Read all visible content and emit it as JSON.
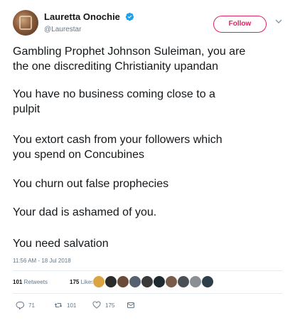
{
  "user": {
    "display_name": "Lauretta Onochie",
    "handle": "@Laurestar",
    "verified": true,
    "follow_label": "Follow"
  },
  "tweet": {
    "paragraphs": [
      [
        "Gambling Prophet Johnson Suleiman, you are",
        "the one discrediting Christianity upandan"
      ],
      [
        "You have no business coming close to a",
        "pulpit"
      ],
      [
        "You extort cash from your followers which",
        "you spend  on Concubines"
      ],
      [
        "You churn out false prophecies"
      ],
      [
        "Your dad is ashamed of you."
      ],
      [
        "You need salvation"
      ]
    ],
    "timestamp": "11:56 AM - 18 Jul 2018"
  },
  "stats": {
    "retweets_count": "101",
    "retweets_label": "Retweets",
    "likes_count": "175",
    "likes_label": "Likes"
  },
  "actions": {
    "reply_count": "71",
    "retweet_count": "101",
    "like_count": "175"
  },
  "colors": {
    "follow": "#e0245e",
    "verified": "#1da1f2",
    "muted": "#657786"
  }
}
